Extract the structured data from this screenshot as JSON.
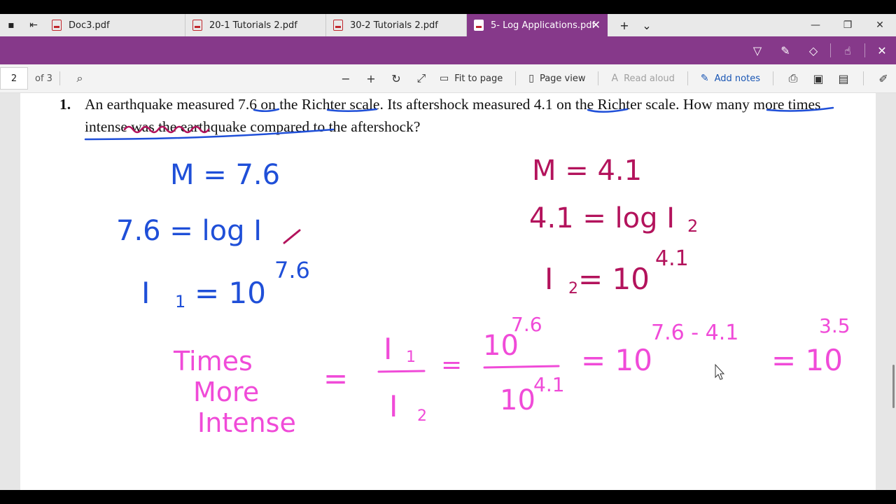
{
  "tabs": [
    {
      "label": "Doc3.pdf",
      "active": false
    },
    {
      "label": "20-1 Tutorials 2.pdf",
      "active": false
    },
    {
      "label": "30-2 Tutorials 2.pdf",
      "active": false
    },
    {
      "label": "5- Log Applications.pdf",
      "active": true
    }
  ],
  "toolbar": {
    "page_number": "2",
    "of_pages": "of 3",
    "fit_to_page": "Fit to page",
    "page_view": "Page view",
    "read_aloud": "Read aloud",
    "add_notes": "Add notes"
  },
  "problem": {
    "number": "1.",
    "text": "An earthquake measured 7.6 on the Richter scale.  Its aftershock measured 4.1 on the Richter scale.  How many more times intense was the earthquake compared to the aftershock?"
  },
  "ink": {
    "left": {
      "m": "M = 7.6",
      "eq": "7.6 = log I",
      "i1": "I",
      "i1_sub": "1",
      "equals": "= 10",
      "exp": "7.6"
    },
    "right": {
      "m": "M = 4.1",
      "eq": "4.1 = log I",
      "eq_sub": "2",
      "i2": "I",
      "i2_sub": "2",
      "equals": "= 10",
      "exp": "4.1"
    },
    "bottom": {
      "label_1": "Times",
      "label_2": "More",
      "label_3": "Intense",
      "eq1": "=",
      "frac1_num": "I",
      "frac1_num_sub": "1",
      "frac1_den": "I",
      "frac1_den_sub": "2",
      "eq2": "=",
      "frac2_num": "10",
      "frac2_num_exp": "7.6",
      "frac2_den": "10",
      "frac2_den_exp": "4.1",
      "eq3": "= 10",
      "eq3_exp": "7.6 - 4.1",
      "eq4": "= 10",
      "eq4_exp": "3.5"
    }
  },
  "colors": {
    "accent": "#86398a",
    "blue_ink": "#1f4fd8",
    "magenta_ink": "#b3135c",
    "pink_ink": "#f04bd8"
  }
}
